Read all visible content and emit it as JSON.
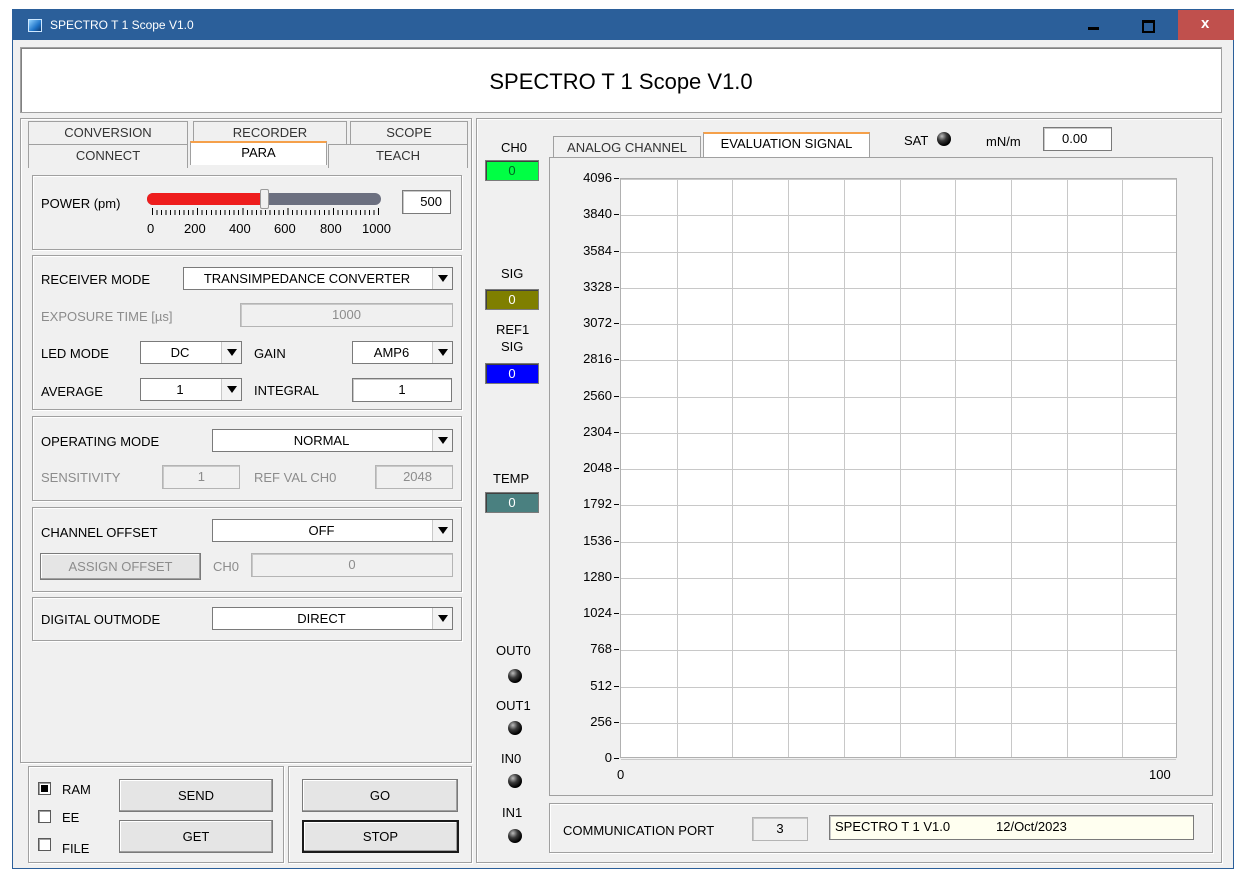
{
  "window": {
    "title": "SPECTRO T 1 Scope V1.0"
  },
  "header": {
    "title": "SPECTRO T 1 Scope V1.0"
  },
  "tabs_top": [
    "CONVERSION",
    "RECORDER",
    "SCOPE"
  ],
  "tabs_bottom": [
    "CONNECT",
    "PARA",
    "TEACH"
  ],
  "active_tab": "PARA",
  "power": {
    "label": "POWER (pm)",
    "value": "500",
    "level": 500,
    "max": 1000,
    "scale": [
      "0",
      "200",
      "400",
      "600",
      "800",
      "1000"
    ]
  },
  "receiver": {
    "mode_label": "RECEIVER MODE",
    "mode_value": "TRANSIMPEDANCE CONVERTER",
    "exposure_label": "EXPOSURE TIME [µs]",
    "exposure_value": "1000",
    "led_label": "LED MODE",
    "led_value": "DC",
    "gain_label": "GAIN",
    "gain_value": "AMP6",
    "average_label": "AVERAGE",
    "average_value": "1",
    "integral_label": "INTEGRAL",
    "integral_value": "1"
  },
  "operating": {
    "mode_label": "OPERATING MODE",
    "mode_value": "NORMAL",
    "sensitivity_label": "SENSITIVITY",
    "sensitivity_value": "1",
    "refval_label": "REF VAL CH0",
    "refval_value": "2048"
  },
  "offset": {
    "label": "CHANNEL OFFSET",
    "value": "OFF",
    "assign_label": "ASSIGN OFFSET",
    "ch_label": "CH0",
    "ch_value": "0"
  },
  "digital": {
    "label": "DIGITAL OUTMODE",
    "value": "DIRECT"
  },
  "memory": {
    "ram": "RAM",
    "ee": "EE",
    "file": "FILE"
  },
  "buttons": {
    "send": "SEND",
    "get": "GET",
    "go": "GO",
    "stop": "STOP"
  },
  "indicators": {
    "ch0_label": "CH0",
    "ch0_value": "0",
    "ch0_color": "#00ff44",
    "sig_label": "SIG",
    "sig_value": "0",
    "sig_color": "#7f7f00",
    "ref1_label": "REF1",
    "ref1_sub": "SIG",
    "ref1_value": "0",
    "ref1_color": "#0000ff",
    "temp_label": "TEMP",
    "temp_value": "0",
    "temp_color": "#4a8080",
    "out0": "OUT0",
    "out1": "OUT1",
    "in0": "IN0",
    "in1": "IN1"
  },
  "scope_tabs": [
    "ANALOG CHANNEL",
    "EVALUATION SIGNAL"
  ],
  "scope_active": "EVALUATION SIGNAL",
  "sat": {
    "label": "SAT",
    "unit": "mN/m",
    "value": "0.00"
  },
  "chart_data": {
    "type": "line",
    "title": "",
    "xlabel": "",
    "ylabel": "",
    "xlim": [
      0,
      100
    ],
    "ylim": [
      0,
      4096
    ],
    "x_ticks": [
      "0",
      "100"
    ],
    "y_ticks": [
      "4096",
      "3840",
      "3584",
      "3328",
      "3072",
      "2816",
      "2560",
      "2304",
      "2048",
      "1792",
      "1536",
      "1280",
      "1024",
      "768",
      "512",
      "256",
      "0"
    ],
    "grid": true,
    "series": []
  },
  "comm": {
    "label": "COMMUNICATION PORT",
    "port": "3",
    "device": "SPECTRO T 1 V1.0",
    "date": "12/Oct/2023"
  }
}
